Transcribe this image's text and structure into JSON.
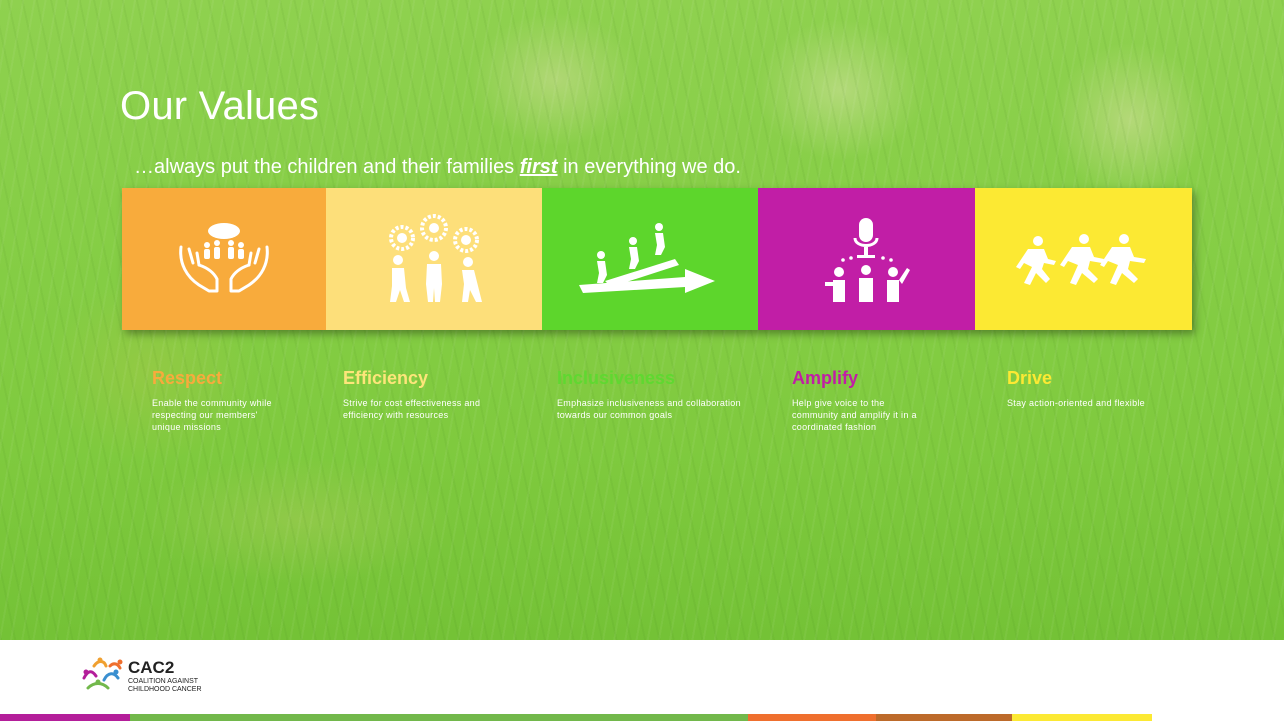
{
  "slide": {
    "title": "Our Values",
    "subtitle_pre": "…always put the children and their families ",
    "subtitle_emph": "first",
    "subtitle_post": " in everything we do."
  },
  "values": [
    {
      "title": "Respect",
      "description": "Enable the community while respecting our members' unique missions",
      "tile_color": "#f8ab3c",
      "title_color": "#f8ab3c",
      "icon": "hands-holding-people-icon"
    },
    {
      "title": "Efficiency",
      "description": "Strive for cost effectiveness and efficiency with resources",
      "tile_color": "#fddf7a",
      "title_color": "#fde57a",
      "icon": "people-gears-icon"
    },
    {
      "title": "Inclusiveness",
      "description": "Emphasize inclusiveness and collaboration towards our common goals",
      "tile_color": "#5dd62c",
      "title_color": "#5fd830",
      "icon": "people-climbing-arrow-icon"
    },
    {
      "title": "Amplify",
      "description": "Help give voice to the community and amplify it in a coordinated fashion",
      "tile_color": "#c11ea6",
      "title_color": "#c11ea6",
      "icon": "microphone-people-icon"
    },
    {
      "title": "Drive",
      "description": "Stay action-oriented and flexible",
      "tile_color": "#fce933",
      "title_color": "#fce933",
      "icon": "running-people-icon"
    }
  ],
  "footer": {
    "logo_name": "CAC2",
    "logo_sub_1": "COALITION AGAINST",
    "logo_sub_2": "CHILDHOOD CANCER",
    "bar_colors": [
      "#b41e9a",
      "#72b84b",
      "#ef6f2e",
      "#bd6a2a",
      "#fce933"
    ]
  }
}
